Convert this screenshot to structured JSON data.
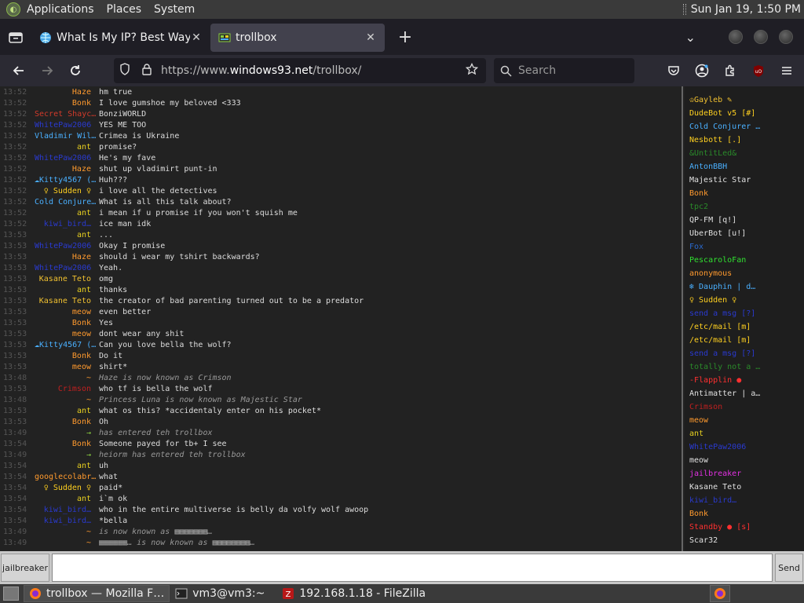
{
  "top_panel": {
    "menus": [
      "Applications",
      "Places",
      "System"
    ],
    "clock": "Sun Jan 19,  1:50 PM"
  },
  "tabs": [
    {
      "title": "What Is My IP? Best Way To",
      "favicon": "globe-icon",
      "active": false
    },
    {
      "title": "trollbox",
      "favicon": "trollbox-icon",
      "active": true
    }
  ],
  "navbar": {
    "url_prefix": "https://www.",
    "url_domain": "windows93.net",
    "url_path": "/trollbox/",
    "search_placeholder": "Search"
  },
  "chat": [
    {
      "time": "13:52",
      "nick": "Haze",
      "color": "#ff9a2e",
      "msg": "hm true"
    },
    {
      "time": "13:52",
      "nick": "Bonk",
      "color": "#ff9a2e",
      "msg": "I love gumshoe my beloved <333"
    },
    {
      "time": "13:52",
      "nick": "Secret Shayc…",
      "color": "#d23a2a",
      "msg": "BonziWORLD"
    },
    {
      "time": "13:52",
      "nick": "WhitePaw2006",
      "color": "#2a3ad0",
      "msg": "YES ME TOO"
    },
    {
      "time": "13:52",
      "nick": "Vladimir Wil…",
      "color": "#4ab0ff",
      "msg": "Crimea is Ukraine"
    },
    {
      "time": "13:52",
      "nick": "ant",
      "color": "#e8d020",
      "msg": "promise?"
    },
    {
      "time": "13:52",
      "nick": "WhitePaw2006",
      "color": "#2a3ad0",
      "msg": "He's my fave"
    },
    {
      "time": "13:52",
      "nick": "Haze",
      "color": "#ff9a2e",
      "msg": "shut up vladimirt punt-in"
    },
    {
      "time": "13:52",
      "nick": "☁Kitty4567 (…",
      "color": "#4ab0ff",
      "msg": "Huh???"
    },
    {
      "time": "13:52",
      "nick": "♀ Sudden ♀",
      "color": "#ffd020",
      "msg": "i love all the detectives"
    },
    {
      "time": "13:52",
      "nick": "Cold Conjure…",
      "color": "#4ab0ff",
      "msg": "What is all this talk about?"
    },
    {
      "time": "13:52",
      "nick": "ant",
      "color": "#e8d020",
      "msg": "i mean if u promise if you won't squish me"
    },
    {
      "time": "13:52",
      "nick": "kiwi_bird…",
      "color": "#2a3ad0",
      "msg": "ice man idk"
    },
    {
      "time": "13:53",
      "nick": "ant",
      "color": "#e8d020",
      "msg": "..."
    },
    {
      "time": "13:53",
      "nick": "WhitePaw2006",
      "color": "#2a3ad0",
      "msg": "Okay I promise"
    },
    {
      "time": "13:53",
      "nick": "Haze",
      "color": "#ff9a2e",
      "msg": "should i wear my tshirt backwards?"
    },
    {
      "time": "13:53",
      "nick": "WhitePaw2006",
      "color": "#2a3ad0",
      "msg": "Yeah."
    },
    {
      "time": "13:53",
      "nick": "Kasane Teto",
      "color": "#f0c030",
      "msg": "omg"
    },
    {
      "time": "13:53",
      "nick": "ant",
      "color": "#e8d020",
      "msg": "thanks"
    },
    {
      "time": "13:53",
      "nick": "Kasane Teto",
      "color": "#f0c030",
      "msg": "the creator of bad parenting turned out to be a predator"
    },
    {
      "time": "13:53",
      "nick": "meow",
      "color": "#ff9a2e",
      "msg": "even better"
    },
    {
      "time": "13:53",
      "nick": "Bonk",
      "color": "#ff9a2e",
      "msg": "Yes"
    },
    {
      "time": "13:53",
      "nick": "meow",
      "color": "#ff9a2e",
      "msg": "dont wear any shit"
    },
    {
      "time": "13:53",
      "nick": "☁Kitty4567 (…",
      "color": "#4ab0ff",
      "msg": "Can you love bella the wolf?"
    },
    {
      "time": "13:53",
      "nick": "Bonk",
      "color": "#ff9a2e",
      "msg": "Do it"
    },
    {
      "time": "13:53",
      "nick": "meow",
      "color": "#ff9a2e",
      "msg": "shirt*"
    },
    {
      "time": "13:48",
      "nick": "~",
      "color": "#ff9a2e",
      "msg": "Haze is now known as Crimson",
      "sys": true
    },
    {
      "time": "13:53",
      "nick": "Crimson",
      "color": "#c02020",
      "msg": "who tf is bella the wolf"
    },
    {
      "time": "13:48",
      "nick": "~",
      "color": "#ff9a2e",
      "msg": "Princess Luna is now known as Majestic Star",
      "sys": true
    },
    {
      "time": "13:53",
      "nick": "ant",
      "color": "#e8d020",
      "msg": "what os this? *accidentaly enter on his pocket*"
    },
    {
      "time": "13:53",
      "nick": "Bonk",
      "color": "#ff9a2e",
      "msg": "Oh"
    },
    {
      "time": "13:49",
      "nick": "→",
      "color": "#8ad040",
      "msg": "   has entered teh trollbox",
      "sys": true
    },
    {
      "time": "13:54",
      "nick": "Bonk",
      "color": "#ff9a2e",
      "msg": "Someone payed for tb+ I see"
    },
    {
      "time": "13:49",
      "nick": "→",
      "color": "#8ad040",
      "msg": "heiorm has entered teh trollbox",
      "sys": true
    },
    {
      "time": "13:54",
      "nick": "ant",
      "color": "#e8d020",
      "msg": "uh"
    },
    {
      "time": "13:54",
      "nick": "googlecolabr…",
      "color": "#ff9a2e",
      "msg": "what"
    },
    {
      "time": "13:54",
      "nick": "♀ Sudden ♀",
      "color": "#ffd020",
      "msg": "paid*"
    },
    {
      "time": "13:54",
      "nick": "ant",
      "color": "#e8d020",
      "msg": "i`m ok"
    },
    {
      "time": "13:54",
      "nick": "kiwi_bird…",
      "color": "#2a3ad0",
      "msg": "who in the entire multiverse is belly da volfy wolf awoop"
    },
    {
      "time": "13:54",
      "nick": "kiwi_bird…",
      "color": "#2a3ad0",
      "msg": "*bella"
    },
    {
      "time": "13:49",
      "nick": "~",
      "color": "#ff9a2e",
      "msg": "   is now known as ▦▦▦▦▦▦▦…",
      "sys": true
    },
    {
      "time": "13:49",
      "nick": "~",
      "color": "#ff9a2e",
      "msg": "▦▦▦▦▦▦…  is now known as ▦▦▦▦▦▦▦▦…",
      "sys": true
    }
  ],
  "users": [
    {
      "name": "♔Gayleb ✎",
      "color": "#f0c030"
    },
    {
      "name": "DudeBot v5 [#]",
      "color": "#ffd020"
    },
    {
      "name": "Cold Conjurer …",
      "color": "#4ab0ff"
    },
    {
      "name": "Nesbott [.]",
      "color": "#ffd020"
    },
    {
      "name": "&UntitLed&",
      "color": "#2a8a2a"
    },
    {
      "name": "AntonBBH",
      "color": "#4ab0ff"
    },
    {
      "name": "Majestic Star",
      "color": "#e0e0e0"
    },
    {
      "name": "Bonk",
      "color": "#ff9a2e"
    },
    {
      "name": "tpc2",
      "color": "#2a8a2a"
    },
    {
      "name": "QP-FM [q!]",
      "color": "#e0e0e0"
    },
    {
      "name": "UberBot [u!]",
      "color": "#e0e0e0"
    },
    {
      "name": "Fox",
      "color": "#2a6ad0"
    },
    {
      "name": "PescaroloFan",
      "color": "#30e030"
    },
    {
      "name": "anonymous",
      "color": "#ff9a2e"
    },
    {
      "name": "❄ Dauphin | d…",
      "color": "#4ab0ff"
    },
    {
      "name": "♀ Sudden ♀",
      "color": "#ffd020"
    },
    {
      "name": "send a msg [?]",
      "color": "#2a3ad0"
    },
    {
      "name": "/etc/mail [m]",
      "color": "#ffd020"
    },
    {
      "name": "/etc/mail [m]",
      "color": "#ffd020"
    },
    {
      "name": "send a msg [?]",
      "color": "#2a3ad0"
    },
    {
      "name": "totally not a …",
      "color": "#2a8a2a"
    },
    {
      "name": "-Flapplin ●",
      "color": "#ff3030"
    },
    {
      "name": "Antimatter | a…",
      "color": "#e0e0e0"
    },
    {
      "name": "Crimson",
      "color": "#c02020"
    },
    {
      "name": "meow",
      "color": "#ff9a2e"
    },
    {
      "name": "ant",
      "color": "#e8d020"
    },
    {
      "name": "WhitePaw2006",
      "color": "#2a3ad0"
    },
    {
      "name": "meow",
      "color": "#e0e0e0"
    },
    {
      "name": "jailbreaker",
      "color": "#e030e0"
    },
    {
      "name": "Kasane Teto",
      "color": "#e0e0e0"
    },
    {
      "name": "kiwi_bird…",
      "color": "#2a3ad0"
    },
    {
      "name": "Bonk",
      "color": "#ff9a2e"
    },
    {
      "name": "Standby ● [s]",
      "color": "#ff3030"
    },
    {
      "name": "Scar32",
      "color": "#e0e0e0"
    }
  ],
  "input": {
    "nick_label": "jailbreaker",
    "send_label": "Send"
  },
  "taskbar": {
    "items": [
      {
        "label": "trollbox — Mozilla F…",
        "icon": "firefox-icon",
        "active": true
      },
      {
        "label": "vm3@vm3:~",
        "icon": "terminal-icon",
        "active": false
      },
      {
        "label": "192.168.1.18 - FileZilla",
        "icon": "filezilla-icon",
        "active": false
      }
    ]
  }
}
